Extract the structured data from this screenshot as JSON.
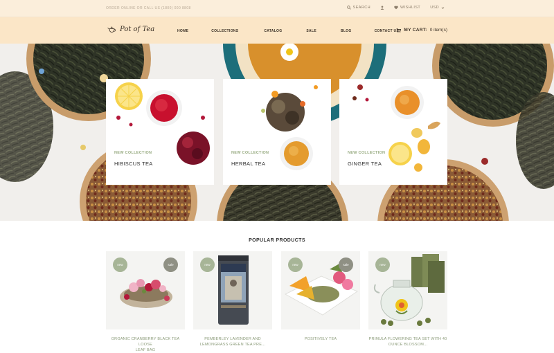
{
  "topbar": {
    "contact": "ORDER ONLINE OR CALL US (1800) 000 8808",
    "search_label": "SEARCH",
    "wishlist_label": "WISHLIST",
    "currency": "USD"
  },
  "header": {
    "logo_text": "Pot of Tea",
    "nav": [
      "HOME",
      "COLLECTIONS",
      "CATALOG",
      "SALE",
      "BLOG",
      "CONTACT US"
    ],
    "cart_label": "MY CART:",
    "cart_count": "0 item(s)"
  },
  "hero": {
    "cards": [
      {
        "kicker": "NEW COLLECTION",
        "title": "HIBISCUS TEA"
      },
      {
        "kicker": "NEW COLLECTION",
        "title": "HERBAL TEA"
      },
      {
        "kicker": "NEW COLLECTION",
        "title": "GINGER TEA"
      }
    ]
  },
  "popular": {
    "title": "POPULAR PRODUCTS",
    "badge_new": "new",
    "badge_sale": "sale",
    "products": [
      {
        "name_line1": "ORGANIC CRANBERRY BLACK TEA LOOSE",
        "name_line2": "LEAF BAG"
      },
      {
        "name_line1": "PEMBERLEY LAVENDER AND",
        "name_line2": "LEMONGRASS GREEN TEA PRE..."
      },
      {
        "name_line1": "POSITIVELY TEA",
        "name_line2": ""
      },
      {
        "name_line1": "PRIMULA FLOWERING TEA SET WITH 40",
        "name_line2": "OUNCE BLOSSOM..."
      }
    ]
  },
  "colors": {
    "topbar_bg": "#fbeedb",
    "header_bg": "#fbe6c7",
    "accent_green": "#9aad84",
    "badge_new": "#a7b597",
    "badge_sale": "#8f9084"
  }
}
